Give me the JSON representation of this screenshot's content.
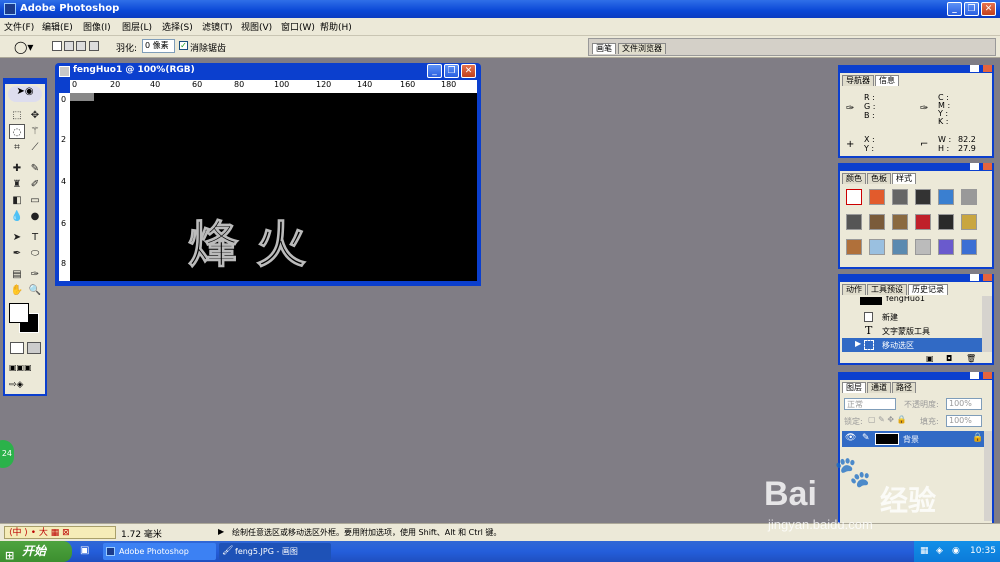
{
  "app": {
    "title": "Adobe Photoshop"
  },
  "menu": [
    "文件(F)",
    "编辑(E)",
    "图像(I)",
    "图层(L)",
    "选择(S)",
    "滤镜(T)",
    "视图(V)",
    "窗口(W)",
    "帮助(H)"
  ],
  "options": {
    "feather_label": "羽化:",
    "feather_value": "0 像素",
    "antialias_label": "消除锯齿",
    "tab_brushes": "画笔",
    "tab_file_browser": "文件浏览器"
  },
  "document": {
    "title": "fengHuo1 @ 100%(RGB)",
    "ruler_labels": [
      "0",
      "20",
      "40",
      "60",
      "80",
      "100",
      "120",
      "140",
      "160",
      "180"
    ],
    "ruler_v_labels": [
      "0",
      "2",
      "4",
      "6",
      "8"
    ],
    "canvas_text": "烽火"
  },
  "info_panel": {
    "tabs": [
      "导航器",
      "信息"
    ],
    "rgb": [
      "R :",
      "G :",
      "B :"
    ],
    "cmyk": [
      "C :",
      "M :",
      "Y :",
      "K :"
    ],
    "x_label": "X :",
    "y_label": "Y :",
    "w_label": "W :",
    "w_value": "82.2",
    "h_label": "H :",
    "h_value": "27.9"
  },
  "swatches_panel": {
    "tabs": [
      "颜色",
      "色板",
      "样式"
    ]
  },
  "history_panel": {
    "tabs": [
      "动作",
      "工具预设",
      "历史记录"
    ],
    "snapshot": "fengHuo1",
    "items": [
      "新建",
      "文字蒙版工具",
      "移动选区"
    ]
  },
  "layers_panel": {
    "tabs": [
      "图层",
      "通道",
      "路径"
    ],
    "blend_mode": "正常",
    "opacity_label": "不透明度:",
    "opacity_value": "100%",
    "lock_label": "锁定:",
    "fill_label": "填充:",
    "fill_value": "100%",
    "layer_name": "背景"
  },
  "status": {
    "zoom": "1.72 毫米",
    "hint": "绘制任意选区或移动选区外框。要用附加选项，使用 Shift、Alt 和 Ctrl 键。"
  },
  "taskbar": {
    "start": "开始",
    "items": [
      "Adobe Photoshop",
      "feng5.JPG - 画图"
    ],
    "time": "10:35"
  },
  "watermark": {
    "brand": "Bai",
    "brand_cn": "经验",
    "url": "jingyan.baidu.com"
  },
  "badge": "24"
}
